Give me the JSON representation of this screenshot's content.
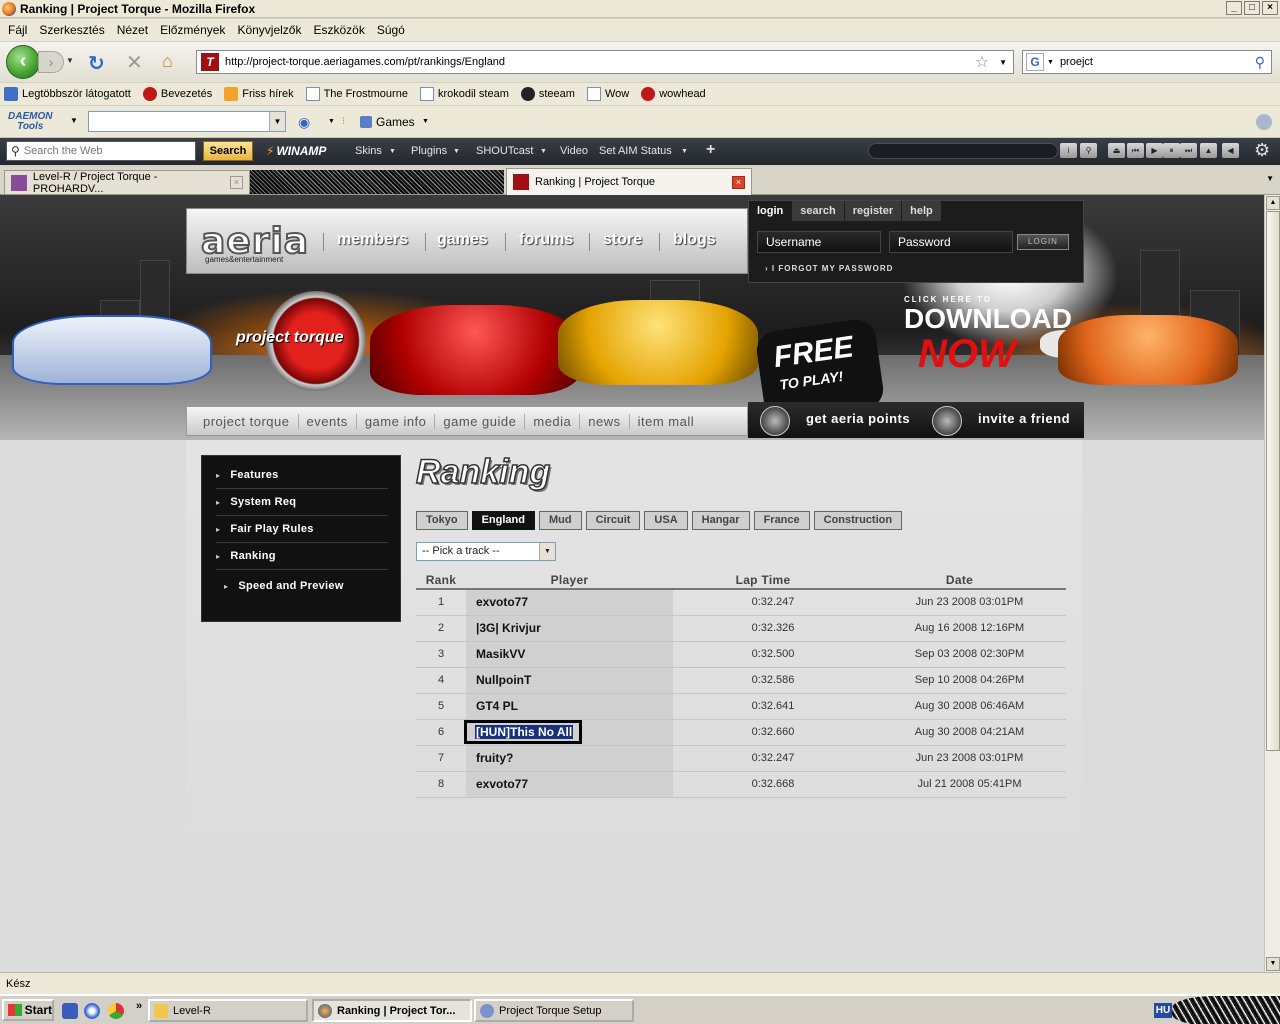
{
  "window": {
    "title": "Ranking | Project Torque - Mozilla Firefox",
    "buttons": [
      "_",
      "□",
      "×"
    ]
  },
  "menu": [
    "Fájl",
    "Szerkesztés",
    "Nézet",
    "Előzmények",
    "Könyvjelzők",
    "Eszközök",
    "Súgó"
  ],
  "navigation": {
    "url": "http://project-torque.aeriagames.com/pt/rankings/England",
    "search_query": "proejct"
  },
  "bookmarks": [
    {
      "label": "Legtöbbször látogatott",
      "icon": "bookmark-folder-icon"
    },
    {
      "label": "Bevezetés",
      "icon": "red-bird-icon"
    },
    {
      "label": "Friss hírek",
      "icon": "rss-icon"
    },
    {
      "label": "The Frostmourne",
      "icon": "page-icon"
    },
    {
      "label": "krokodil steam",
      "icon": "page-icon"
    },
    {
      "label": "steeam",
      "icon": "steam-icon"
    },
    {
      "label": "Wow",
      "icon": "page-icon"
    },
    {
      "label": "wowhead",
      "icon": "wowhead-icon"
    }
  ],
  "daemon_toolbar": {
    "logo_line1": "DAEMON",
    "logo_line2": "Tools",
    "games_label": "Games"
  },
  "winamp_toolbar": {
    "search_placeholder": "Search the Web",
    "search_button": "Search",
    "logo": "WINAMP",
    "menus": [
      "Skins",
      "Plugins",
      "SHOUTcast",
      "Video",
      "Set AIM Status"
    ]
  },
  "tabs": [
    {
      "label": "Level-R / Project Torque - PROHARDV...",
      "active": false
    },
    {
      "label": "Ranking | Project Torque",
      "active": true
    }
  ],
  "site": {
    "logo": "aeria",
    "logo_sub": "games&entertainment",
    "top_links": [
      "members",
      "games",
      "forums",
      "store",
      "blogs"
    ],
    "login_tabs": [
      "login",
      "search",
      "register",
      "help"
    ],
    "username_label": "Username",
    "password_label": "Password",
    "login_button": "LOGIN",
    "forgot_password": "I FORGOT MY PASSWORD",
    "game_logo": "project torque",
    "free_to_play_1": "FREE",
    "free_to_play_2": "TO PLAY!",
    "download_small": "CLICK HERE TO",
    "download_big": "DOWNLOAD",
    "download_now": "NOW",
    "sub_links": [
      "project torque",
      "events",
      "game info",
      "game guide",
      "media",
      "news",
      "item mall"
    ],
    "promo_points": "get aeria points",
    "promo_invite": "invite a friend"
  },
  "sidebar": [
    "Features",
    "System Req",
    "Fair Play Rules",
    "Ranking",
    "Speed and Preview"
  ],
  "ranking": {
    "title": "Ranking",
    "tracks": [
      {
        "label": "Tokyo",
        "active": false
      },
      {
        "label": "England",
        "active": true
      },
      {
        "label": "Mud",
        "active": false
      },
      {
        "label": "Circuit",
        "active": false
      },
      {
        "label": "USA",
        "active": false
      },
      {
        "label": "Hangar",
        "active": false
      },
      {
        "label": "France",
        "active": false
      },
      {
        "label": "Construction",
        "active": false
      }
    ],
    "pick_track": "-- Pick a track --",
    "headers": {
      "rank": "Rank",
      "player": "Player",
      "lap_time": "Lap Time",
      "date": "Date"
    },
    "rows": [
      {
        "rank": "1",
        "player": "exvoto77",
        "time": "0:32.247",
        "date": "Jun 23 2008 03:01PM"
      },
      {
        "rank": "2",
        "player": "|3G| Krivjur",
        "time": "0:32.326",
        "date": "Aug 16 2008 12:16PM"
      },
      {
        "rank": "3",
        "player": "MasikVV",
        "time": "0:32.500",
        "date": "Sep 03 2008 02:30PM"
      },
      {
        "rank": "4",
        "player": "NullpoinT",
        "time": "0:32.586",
        "date": "Sep 10 2008 04:26PM"
      },
      {
        "rank": "5",
        "player": "GT4 PL",
        "time": "0:32.641",
        "date": "Aug 30 2008 06:46AM"
      },
      {
        "rank": "6",
        "player": "[HUN]This No All",
        "time": "0:32.660",
        "date": "Aug 30 2008 04:21AM"
      },
      {
        "rank": "7",
        "player": "fruity?",
        "time": "0:32.247",
        "date": "Jun 23 2008 03:01PM"
      },
      {
        "rank": "8",
        "player": "exvoto77",
        "time": "0:32.668",
        "date": "Jul 21 2008 05:41PM"
      }
    ]
  },
  "status": "Kész",
  "taskbar": {
    "start": "Start",
    "more": "»",
    "tasks": [
      {
        "label": "Level-R",
        "active": false
      },
      {
        "label": "Ranking | Project Tor...",
        "active": true
      },
      {
        "label": "Project Torque Setup",
        "active": false
      }
    ],
    "lang": "HU"
  }
}
